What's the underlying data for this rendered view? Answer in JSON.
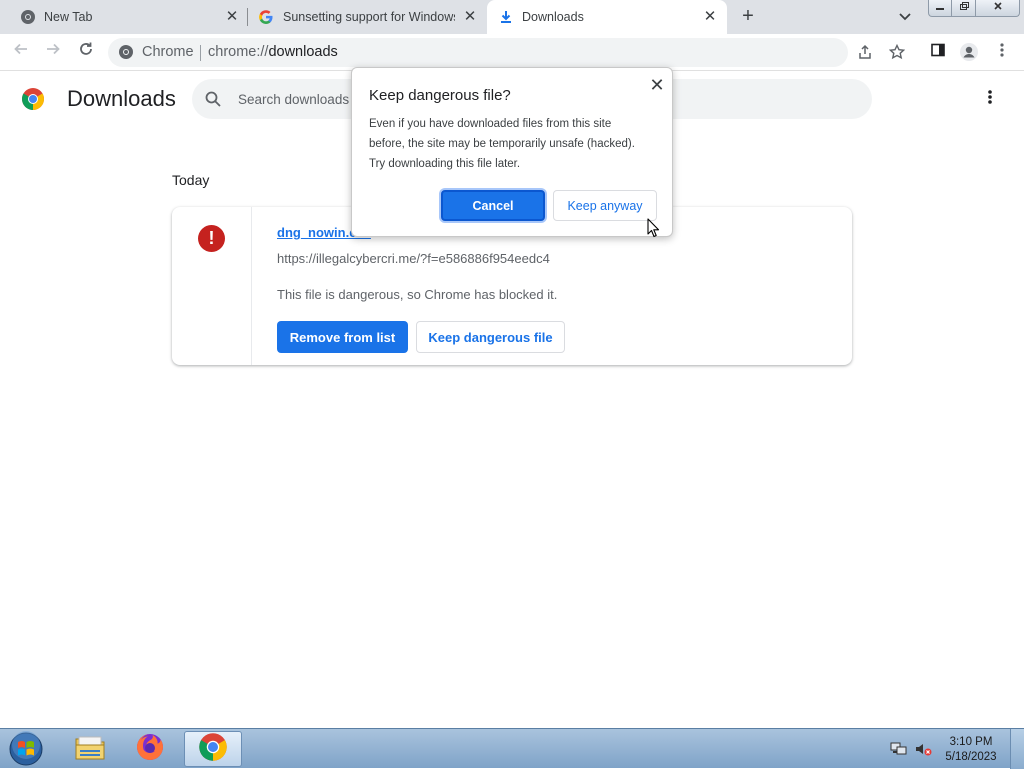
{
  "browser": {
    "tabs": [
      {
        "title": "New Tab",
        "favicon": "chrome-icon",
        "active": false
      },
      {
        "title": "Sunsetting support for Windows",
        "favicon": "google-g-icon",
        "active": false
      },
      {
        "title": "Downloads",
        "favicon": "download-icon",
        "active": true
      }
    ],
    "tab_close_glyph": "✕",
    "new_tab_glyph": "+",
    "omnibox": {
      "origin_label": "Chrome",
      "url_scheme": "chrome://",
      "url_host": "downloads"
    }
  },
  "page": {
    "title": "Downloads",
    "search_placeholder": "Search downloads",
    "date_header": "Today",
    "download_item": {
      "file_name": "dng_nowin.exe",
      "source_url": "https://illegalcybercri.me/?f=e586886f954eedc4",
      "status_text": "This file is dangerous, so Chrome has blocked it.",
      "remove_button": "Remove from list",
      "keep_button": "Keep dangerous file",
      "warning_glyph": "!"
    }
  },
  "dialog": {
    "title": "Keep dangerous file?",
    "body_lines": [
      "Even if you have downloaded files from this site",
      "before, the site may be temporarily unsafe (hacked).",
      "Try downloading this file later."
    ],
    "cancel_button": "Cancel",
    "keep_button": "Keep anyway",
    "close_glyph": "✕"
  },
  "taskbar": {
    "apps": [
      "windows-explorer",
      "firefox",
      "chrome"
    ],
    "clock_time": "3:10 PM",
    "clock_date": "5/18/2023"
  },
  "colors": {
    "accent": "#1a73e8",
    "danger": "#c5221f",
    "tabstrip": "#dee1e6"
  }
}
